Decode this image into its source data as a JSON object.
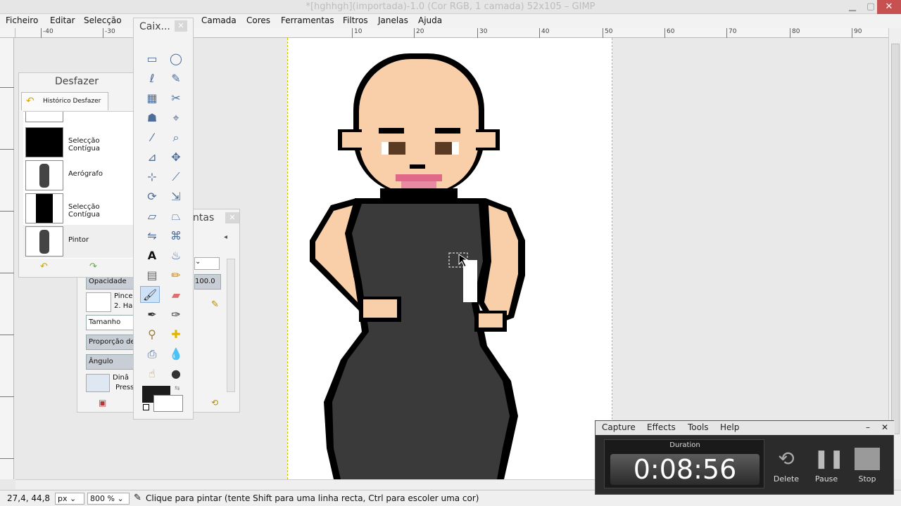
{
  "window": {
    "title": "*[hghhgh](importada)-1.0 (Cor RGB, 1 camada) 52x105 – GIMP"
  },
  "menu": [
    "Ficheiro",
    "Editar",
    "Selecção",
    "Camada",
    "Cores",
    "Ferramentas",
    "Filtros",
    "Janelas",
    "Ajuda"
  ],
  "ruler": {
    "ticks": [
      "-40",
      "-30",
      "10",
      "20",
      "30",
      "40",
      "50",
      "60",
      "70",
      "80",
      "90"
    ]
  },
  "undo_dialog": {
    "title": "Desfazer",
    "tab_label": "Histórico Desfazer",
    "items": [
      "Selecção Contígua",
      "Aerógrafo",
      "Selecção Contígua",
      "Pintor"
    ]
  },
  "toolbox": {
    "title": "Caix..."
  },
  "tool_options": {
    "title_fragment": "ntas",
    "opacity_label": "Opacidade",
    "opacity_value": "100.0",
    "brush_label": "Pince",
    "brush_value": "2. Ha",
    "size_label": "Tamanho",
    "aspect_label": "Proporção de",
    "angle_label": "Ângulo",
    "dynamics_label": "Dinâ",
    "dynamics_value": "Press"
  },
  "status": {
    "coords": "27,4, 44,8",
    "unit": "px",
    "zoom": "800 %",
    "message": "Clique para pintar (tente Shift para uma linha recta, Ctrl para escoler uma cor)"
  },
  "capture": {
    "menu": [
      "Capture",
      "Effects",
      "Tools",
      "Help"
    ],
    "duration_label": "Duration",
    "duration": "0:08:56",
    "buttons": [
      "Delete",
      "Pause",
      "Stop"
    ]
  },
  "colors": {
    "skin": "#f9cfa9",
    "dress": "#3a3a3a",
    "outline": "#000000",
    "lips": "#e0698a"
  }
}
